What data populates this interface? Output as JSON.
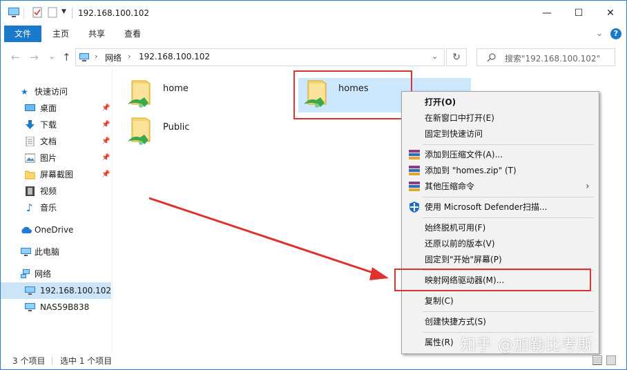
{
  "window": {
    "title": "192.168.100.102",
    "controls": {
      "minimize": "—",
      "maximize": "☐",
      "close": "✕"
    }
  },
  "ribbon": {
    "tabs": [
      {
        "label": "文件",
        "active": true
      },
      {
        "label": "主页"
      },
      {
        "label": "共享"
      },
      {
        "label": "查看"
      }
    ],
    "help": "?"
  },
  "address": {
    "path": [
      "网络",
      "192.168.100.102"
    ],
    "search_placeholder": "搜索\"192.168.100.102\""
  },
  "sidebar": {
    "quick_access": "快速访问",
    "items": [
      {
        "label": "桌面",
        "pinned": true,
        "icon": "desktop-icon"
      },
      {
        "label": "下载",
        "pinned": true,
        "icon": "download-icon"
      },
      {
        "label": "文档",
        "pinned": true,
        "icon": "document-icon"
      },
      {
        "label": "图片",
        "pinned": true,
        "icon": "picture-icon"
      },
      {
        "label": "屏幕截图",
        "pinned": true,
        "icon": "folder-icon"
      },
      {
        "label": "视频",
        "pinned": false,
        "icon": "video-icon"
      },
      {
        "label": "音乐",
        "pinned": false,
        "icon": "music-icon"
      }
    ],
    "onedrive": "OneDrive",
    "this_pc": "此电脑",
    "network": "网络",
    "network_items": [
      {
        "label": "192.168.100.102",
        "selected": true
      },
      {
        "label": "NAS59B838",
        "selected": false
      }
    ]
  },
  "files": [
    {
      "name": "home"
    },
    {
      "name": "homes",
      "selected": true
    },
    {
      "name": "Public"
    }
  ],
  "context_menu": {
    "items": [
      {
        "label": "打开(O)",
        "bold": true
      },
      {
        "label": "在新窗口中打开(E)"
      },
      {
        "label": "固定到快速访问"
      },
      {
        "label": "添加到压缩文件(A)...",
        "icon": "winrar-icon"
      },
      {
        "label": "添加到 \"homes.zip\" (T)",
        "icon": "winrar-icon"
      },
      {
        "label": "其他压缩命令",
        "icon": "winrar-icon",
        "submenu": true
      },
      {
        "label": "使用 Microsoft Defender扫描...",
        "icon": "defender-shield-icon"
      },
      {
        "label": "始终脱机可用(F)"
      },
      {
        "label": "还原以前的版本(V)"
      },
      {
        "label": "固定到\"开始\"屏幕(P)"
      },
      {
        "label": "映射网络驱动器(M)...",
        "highlighted": true
      },
      {
        "label": "复制(C)"
      },
      {
        "label": "创建快捷方式(S)"
      },
      {
        "label": "属性(R)"
      }
    ]
  },
  "status": {
    "count": "3 个项目",
    "selected": "选中 1 个项目"
  },
  "watermark": "知乎 @加勒比考斯",
  "colors": {
    "accent": "#1979ca",
    "selection": "#cce8ff",
    "annotation_red": "#e0322d"
  }
}
